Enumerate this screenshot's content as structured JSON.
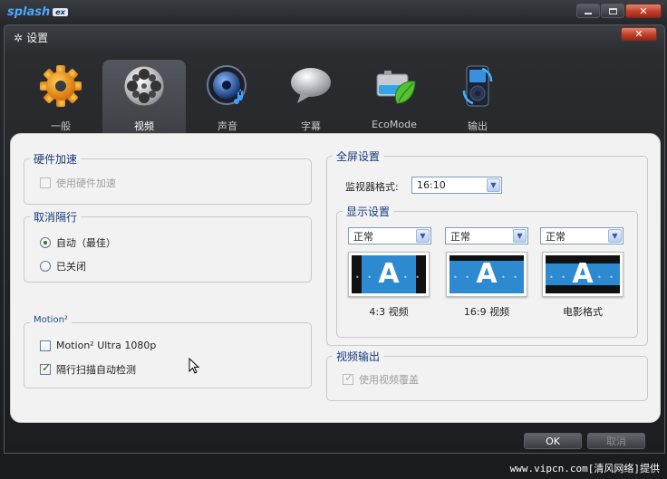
{
  "app": {
    "logo": "splash",
    "logo_badge": "ex"
  },
  "dialog": {
    "title": "设置"
  },
  "tabs": [
    {
      "label": "一般",
      "icon": "gear-icon"
    },
    {
      "label": "视频",
      "icon": "film-reel-icon"
    },
    {
      "label": "声音",
      "icon": "speaker-icon"
    },
    {
      "label": "字幕",
      "icon": "speech-bubble-icon"
    },
    {
      "label": "EcoMode",
      "icon": "battery-leaf-icon"
    },
    {
      "label": "输出",
      "icon": "ipod-icon"
    }
  ],
  "active_tab": "视频",
  "hw_accel": {
    "title": "硬件加速",
    "checkbox_label": "使用硬件加速",
    "checked": false,
    "enabled": false
  },
  "deinterlace": {
    "title": "取消隔行",
    "options": [
      {
        "label": "自动（最佳）",
        "selected": true
      },
      {
        "label": "已关闭",
        "selected": false
      }
    ]
  },
  "motion": {
    "title": "Motion²",
    "items": [
      {
        "label": "Motion² Ultra 1080p",
        "checked": false
      },
      {
        "label": "隔行扫描自动检测",
        "checked": true
      }
    ]
  },
  "fullscreen": {
    "title": "全屏设置",
    "monitor_label": "监视器格式:",
    "monitor_value": "16:10",
    "display": {
      "title": "显示设置",
      "items": [
        {
          "select": "正常",
          "caption": "4:3 视频"
        },
        {
          "select": "正常",
          "caption": "16:9 视频"
        },
        {
          "select": "正常",
          "caption": "电影格式"
        }
      ]
    }
  },
  "video_output": {
    "title": "视频输出",
    "checkbox_label": "使用视频覆盖",
    "checked": true,
    "enabled": false
  },
  "buttons": {
    "ok": "OK",
    "cancel": "取消"
  },
  "watermark": "www.vipcn.com[清风网络]提供",
  "colors": {
    "accent_blue": "#163a7a",
    "preview_blue": "#2d8ad0",
    "close_red": "#c0412c"
  }
}
